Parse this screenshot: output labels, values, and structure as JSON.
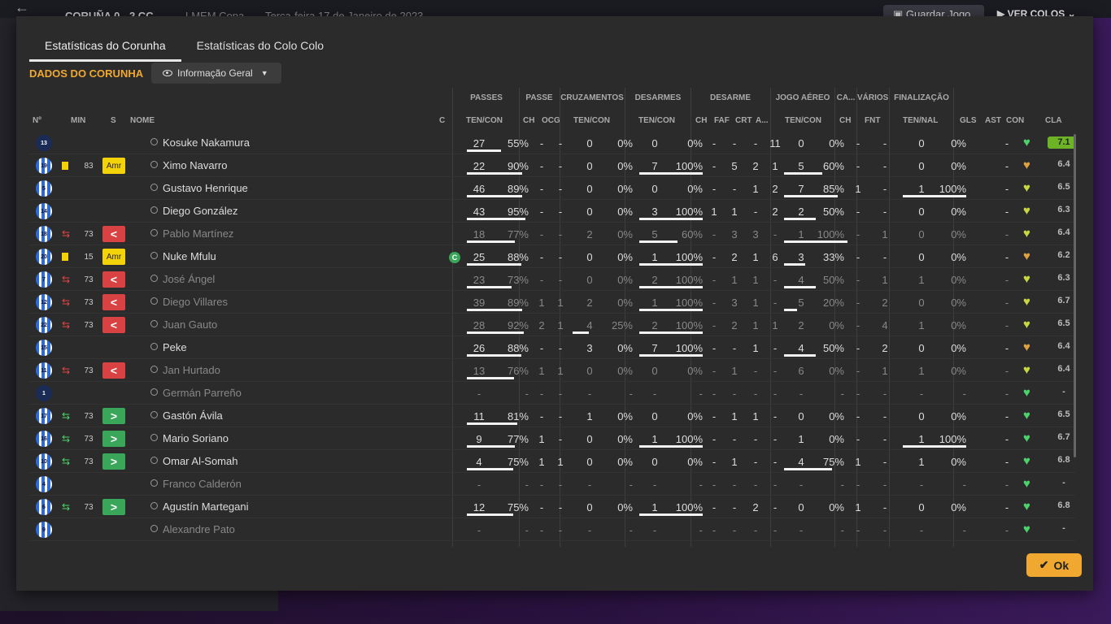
{
  "topbar": {
    "score": "CORUÑA  0 - 2  CC",
    "competition": "LMEM Copa",
    "date": "Terça-feira 17 de Janeiro de 2023",
    "save_label": "Guardar Jogo",
    "view_label": "VER COLOS"
  },
  "tabs": [
    {
      "label": "Estatísticas do Corunha",
      "active": true
    },
    {
      "label": "Estatísticas do Colo Colo",
      "active": false
    }
  ],
  "section_title": "DADOS DO CORUNHA",
  "dropdown_label": "Informação Geral",
  "group_headers": {
    "passes": "PASSES",
    "passe": "PASSE",
    "cruzamentos": "CRUZAMENTOS",
    "desarmes": "DESARMES",
    "desarme": "DESARME",
    "jogo_aereo": "JOGO AÉREO",
    "ca": "CA...",
    "varios": "VÁRIOS",
    "finalizacao": "FINALIZAÇÃO"
  },
  "columns": {
    "no": "Nº",
    "min": "MIN",
    "s": "S",
    "nome": "NOME",
    "c": "C",
    "pass_tc": "TEN/CON",
    "passe_ch": "CH",
    "passe_ocg": "OCG",
    "cruz_tc": "TEN/CON",
    "des_tc": "TEN/CON",
    "d_ch": "CH",
    "d_faf": "FAF",
    "d_crt": "CRT",
    "d_a": "A...",
    "aer_tc": "TEN/CON",
    "ca_ch": "CH",
    "fnt": "FNT",
    "fin_tn": "TEN/NAL",
    "gls": "GLS",
    "ast": "AST",
    "con": "CON",
    "cla": "CLA"
  },
  "players": [
    {
      "num": "13",
      "gk": true,
      "card": "",
      "min": "",
      "s": "",
      "name": "Kosuke Nakamura",
      "dim": false,
      "captain": false,
      "pass": [
        "27",
        "55%"
      ],
      "pch": "-",
      "pocg": "-",
      "cruz": [
        "0",
        "0%"
      ],
      "des": [
        "0",
        "0%"
      ],
      "dch": "-",
      "faf": "-",
      "crt": "-",
      "da": "11",
      "aer": [
        "0",
        "0%"
      ],
      "cach": "-",
      "fnt": "-",
      "fin": [
        "0",
        "0%"
      ],
      "gls": "",
      "ast": "-",
      "con": "green",
      "cla": "7.1",
      "best": true,
      "bars": {
        "pass": 0.55,
        "cruz": 0,
        "des": 0,
        "aer": 0,
        "fin": 0
      }
    },
    {
      "num": "19",
      "gk": false,
      "card": "yellow",
      "min": "83",
      "s": "amr",
      "name": "Ximo Navarro",
      "dim": false,
      "captain": false,
      "pass": [
        "22",
        "90%"
      ],
      "pch": "-",
      "pocg": "-",
      "cruz": [
        "0",
        "0%"
      ],
      "des": [
        "7",
        "100%"
      ],
      "dch": "-",
      "faf": "5",
      "crt": "2",
      "da": "1",
      "aer": [
        "5",
        "60%"
      ],
      "cach": "-",
      "fnt": "-",
      "fin": [
        "0",
        "0%"
      ],
      "gls": "",
      "ast": "-",
      "con": "orange",
      "cla": "6.4",
      "best": false,
      "bars": {
        "pass": 0.9,
        "cruz": 0,
        "des": 1,
        "aer": 0.6,
        "fin": 0
      }
    },
    {
      "num": "5",
      "gk": false,
      "card": "",
      "min": "",
      "s": "",
      "name": "Gustavo Henrique",
      "dim": false,
      "captain": false,
      "pass": [
        "46",
        "89%"
      ],
      "pch": "-",
      "pocg": "-",
      "cruz": [
        "0",
        "0%"
      ],
      "des": [
        "0",
        "0%"
      ],
      "dch": "-",
      "faf": "-",
      "crt": "1",
      "da": "2",
      "aer": [
        "7",
        "85%"
      ],
      "cach": "1",
      "fnt": "-",
      "fin": [
        "1",
        "100%"
      ],
      "gls": "",
      "ast": "-",
      "con": "yellow",
      "cla": "6.5",
      "best": false,
      "bars": {
        "pass": 0.89,
        "cruz": 0,
        "des": 0,
        "aer": 0.85,
        "fin": 1
      }
    },
    {
      "num": "14",
      "gk": false,
      "card": "",
      "min": "",
      "s": "",
      "name": "Diego González",
      "dim": false,
      "captain": false,
      "pass": [
        "43",
        "95%"
      ],
      "pch": "-",
      "pocg": "-",
      "cruz": [
        "0",
        "0%"
      ],
      "des": [
        "3",
        "100%"
      ],
      "dch": "1",
      "faf": "1",
      "crt": "-",
      "da": "2",
      "aer": [
        "2",
        "50%"
      ],
      "cach": "-",
      "fnt": "-",
      "fin": [
        "0",
        "0%"
      ],
      "gls": "",
      "ast": "-",
      "con": "yellow",
      "cla": "6.3",
      "best": false,
      "bars": {
        "pass": 0.95,
        "cruz": 0,
        "des": 1,
        "aer": 0.5,
        "fin": 0
      }
    },
    {
      "num": "18",
      "gk": false,
      "card": "subout",
      "min": "73",
      "s": "out",
      "name": "Pablo Martínez",
      "dim": true,
      "captain": false,
      "pass": [
        "18",
        "77%"
      ],
      "pch": "-",
      "pocg": "-",
      "cruz": [
        "2",
        "0%"
      ],
      "des": [
        "5",
        "60%"
      ],
      "dch": "-",
      "faf": "3",
      "crt": "3",
      "da": "-",
      "aer": [
        "1",
        "100%"
      ],
      "cach": "-",
      "fnt": "1",
      "fin": [
        "0",
        "0%"
      ],
      "gls": "",
      "ast": "-",
      "con": "yellow",
      "cla": "6.4",
      "best": false,
      "bars": {
        "pass": 0.77,
        "cruz": 0,
        "des": 0.6,
        "aer": 1,
        "fin": 0
      }
    },
    {
      "num": "20",
      "gk": false,
      "card": "yellow",
      "min": "15",
      "s": "amr",
      "name": "Nuke Mfulu",
      "dim": false,
      "captain": true,
      "pass": [
        "25",
        "88%"
      ],
      "pch": "-",
      "pocg": "-",
      "cruz": [
        "0",
        "0%"
      ],
      "des": [
        "1",
        "100%"
      ],
      "dch": "-",
      "faf": "2",
      "crt": "1",
      "da": "6",
      "aer": [
        "3",
        "33%"
      ],
      "cach": "-",
      "fnt": "-",
      "fin": [
        "0",
        "0%"
      ],
      "gls": "",
      "ast": "-",
      "con": "orange",
      "cla": "6.2",
      "best": false,
      "bars": {
        "pass": 0.88,
        "cruz": 0,
        "des": 1,
        "aer": 0.33,
        "fin": 0
      }
    },
    {
      "num": "7",
      "gk": false,
      "card": "subout",
      "min": "73",
      "s": "out",
      "name": "José Ángel",
      "dim": true,
      "captain": false,
      "pass": [
        "23",
        "73%"
      ],
      "pch": "-",
      "pocg": "-",
      "cruz": [
        "0",
        "0%"
      ],
      "des": [
        "2",
        "100%"
      ],
      "dch": "-",
      "faf": "1",
      "crt": "1",
      "da": "-",
      "aer": [
        "4",
        "50%"
      ],
      "cach": "-",
      "fnt": "1",
      "fin": [
        "1",
        "0%"
      ],
      "gls": "",
      "ast": "-",
      "con": "yellow",
      "cla": "6.3",
      "best": false,
      "bars": {
        "pass": 0.73,
        "cruz": 0,
        "des": 1,
        "aer": 0.5,
        "fin": 0
      }
    },
    {
      "num": "12",
      "gk": false,
      "card": "subout",
      "min": "73",
      "s": "out",
      "name": "Diego Villares",
      "dim": true,
      "captain": false,
      "pass": [
        "39",
        "89%"
      ],
      "pch": "1",
      "pocg": "1",
      "cruz": [
        "2",
        "0%"
      ],
      "des": [
        "1",
        "100%"
      ],
      "dch": "-",
      "faf": "3",
      "crt": "1",
      "da": "-",
      "aer": [
        "5",
        "20%"
      ],
      "cach": "-",
      "fnt": "2",
      "fin": [
        "0",
        "0%"
      ],
      "gls": "",
      "ast": "-",
      "con": "yellow",
      "cla": "6.7",
      "best": false,
      "bars": {
        "pass": 0.89,
        "cruz": 0,
        "des": 1,
        "aer": 0.2,
        "fin": 0
      }
    },
    {
      "num": "22",
      "gk": false,
      "card": "subout",
      "min": "73",
      "s": "out",
      "name": "Juan Gauto",
      "dim": true,
      "captain": false,
      "pass": [
        "28",
        "92%"
      ],
      "pch": "2",
      "pocg": "1",
      "cruz": [
        "4",
        "25%"
      ],
      "des": [
        "2",
        "100%"
      ],
      "dch": "-",
      "faf": "2",
      "crt": "1",
      "da": "1",
      "aer": [
        "2",
        "0%"
      ],
      "cach": "-",
      "fnt": "4",
      "fin": [
        "1",
        "0%"
      ],
      "gls": "",
      "ast": "-",
      "con": "yellow",
      "cla": "6.5",
      "best": false,
      "bars": {
        "pass": 0.92,
        "cruz": 0.25,
        "des": 1,
        "aer": 0,
        "fin": 0
      }
    },
    {
      "num": "15",
      "gk": false,
      "card": "",
      "min": "",
      "s": "",
      "name": "Peke",
      "dim": false,
      "captain": false,
      "pass": [
        "26",
        "88%"
      ],
      "pch": "-",
      "pocg": "-",
      "cruz": [
        "3",
        "0%"
      ],
      "des": [
        "7",
        "100%"
      ],
      "dch": "-",
      "faf": "-",
      "crt": "1",
      "da": "-",
      "aer": [
        "4",
        "50%"
      ],
      "cach": "-",
      "fnt": "2",
      "fin": [
        "0",
        "0%"
      ],
      "gls": "",
      "ast": "-",
      "con": "orange",
      "cla": "6.4",
      "best": false,
      "bars": {
        "pass": 0.88,
        "cruz": 0,
        "des": 1,
        "aer": 0.5,
        "fin": 0
      }
    },
    {
      "num": "11",
      "gk": false,
      "card": "subout",
      "min": "73",
      "s": "out",
      "name": "Jan Hurtado",
      "dim": true,
      "captain": false,
      "pass": [
        "13",
        "76%"
      ],
      "pch": "1",
      "pocg": "1",
      "cruz": [
        "0",
        "0%"
      ],
      "des": [
        "0",
        "0%"
      ],
      "dch": "-",
      "faf": "1",
      "crt": "-",
      "da": "-",
      "aer": [
        "6",
        "0%"
      ],
      "cach": "-",
      "fnt": "1",
      "fin": [
        "1",
        "0%"
      ],
      "gls": "",
      "ast": "-",
      "con": "yellow",
      "cla": "6.4",
      "best": false,
      "bars": {
        "pass": 0.76,
        "cruz": 0,
        "des": 0,
        "aer": 0,
        "fin": 0
      }
    },
    {
      "num": "1",
      "gk": true,
      "card": "",
      "min": "",
      "s": "",
      "name": "Germán Parreño",
      "dim": true,
      "captain": false,
      "pass": [
        "-",
        "-"
      ],
      "pch": "-",
      "pocg": "-",
      "cruz": [
        "-",
        "-"
      ],
      "des": [
        "-",
        "-"
      ],
      "dch": "-",
      "faf": "-",
      "crt": "-",
      "da": "-",
      "aer": [
        "-",
        "-"
      ],
      "cach": "-",
      "fnt": "-",
      "fin": [
        "-",
        "-"
      ],
      "gls": "",
      "ast": "-",
      "con": "green",
      "cla": "-",
      "best": false,
      "bars": {
        "pass": 0,
        "cruz": 0,
        "des": 0,
        "aer": 0,
        "fin": 0
      }
    },
    {
      "num": "17",
      "gk": false,
      "card": "subin",
      "min": "73",
      "s": "in",
      "name": "Gastón Ávila",
      "dim": false,
      "captain": false,
      "pass": [
        "11",
        "81%"
      ],
      "pch": "-",
      "pocg": "-",
      "cruz": [
        "1",
        "0%"
      ],
      "des": [
        "0",
        "0%"
      ],
      "dch": "-",
      "faf": "1",
      "crt": "1",
      "da": "-",
      "aer": [
        "0",
        "0%"
      ],
      "cach": "-",
      "fnt": "-",
      "fin": [
        "0",
        "0%"
      ],
      "gls": "",
      "ast": "-",
      "con": "green",
      "cla": "6.5",
      "best": false,
      "bars": {
        "pass": 0.81,
        "cruz": 0,
        "des": 0,
        "aer": 0,
        "fin": 0
      }
    },
    {
      "num": "16",
      "gk": false,
      "card": "subin",
      "min": "73",
      "s": "in",
      "name": "Mario Soriano",
      "dim": false,
      "captain": false,
      "pass": [
        "9",
        "77%"
      ],
      "pch": "1",
      "pocg": "-",
      "cruz": [
        "0",
        "0%"
      ],
      "des": [
        "1",
        "100%"
      ],
      "dch": "-",
      "faf": "-",
      "crt": "-",
      "da": "-",
      "aer": [
        "1",
        "0%"
      ],
      "cach": "-",
      "fnt": "-",
      "fin": [
        "1",
        "100%"
      ],
      "gls": "",
      "ast": "-",
      "con": "green",
      "cla": "6.7",
      "best": false,
      "bars": {
        "pass": 0.77,
        "cruz": 0,
        "des": 1,
        "aer": 0,
        "fin": 1
      }
    },
    {
      "num": "10",
      "gk": false,
      "card": "subin",
      "min": "73",
      "s": "in",
      "name": "Omar Al-Somah",
      "dim": false,
      "captain": false,
      "pass": [
        "4",
        "75%"
      ],
      "pch": "1",
      "pocg": "1",
      "cruz": [
        "0",
        "0%"
      ],
      "des": [
        "0",
        "0%"
      ],
      "dch": "-",
      "faf": "1",
      "crt": "-",
      "da": "-",
      "aer": [
        "4",
        "75%"
      ],
      "cach": "1",
      "fnt": "-",
      "fin": [
        "1",
        "0%"
      ],
      "gls": "",
      "ast": "-",
      "con": "green",
      "cla": "6.8",
      "best": false,
      "bars": {
        "pass": 0.75,
        "cruz": 0,
        "des": 0,
        "aer": 0.75,
        "fin": 0
      }
    },
    {
      "num": "4",
      "gk": false,
      "card": "",
      "min": "",
      "s": "",
      "name": "Franco Calderón",
      "dim": true,
      "captain": false,
      "pass": [
        "-",
        "-"
      ],
      "pch": "-",
      "pocg": "-",
      "cruz": [
        "-",
        "-"
      ],
      "des": [
        "-",
        "-"
      ],
      "dch": "-",
      "faf": "-",
      "crt": "-",
      "da": "-",
      "aer": [
        "-",
        "-"
      ],
      "cach": "-",
      "fnt": "-",
      "fin": [
        "-",
        "-"
      ],
      "gls": "",
      "ast": "-",
      "con": "green",
      "cla": "-",
      "best": false,
      "bars": {
        "pass": 0,
        "cruz": 0,
        "des": 0,
        "aer": 0,
        "fin": 0
      }
    },
    {
      "num": "6",
      "gk": false,
      "card": "subin",
      "min": "73",
      "s": "in",
      "name": "Agustín Martegani",
      "dim": false,
      "captain": false,
      "pass": [
        "12",
        "75%"
      ],
      "pch": "-",
      "pocg": "-",
      "cruz": [
        "0",
        "0%"
      ],
      "des": [
        "1",
        "100%"
      ],
      "dch": "-",
      "faf": "-",
      "crt": "2",
      "da": "-",
      "aer": [
        "0",
        "0%"
      ],
      "cach": "1",
      "fnt": "-",
      "fin": [
        "0",
        "0%"
      ],
      "gls": "",
      "ast": "-",
      "con": "green",
      "cla": "6.8",
      "best": false,
      "bars": {
        "pass": 0.75,
        "cruz": 0,
        "des": 1,
        "aer": 0,
        "fin": 0
      }
    },
    {
      "num": "9",
      "gk": false,
      "card": "",
      "min": "",
      "s": "",
      "name": "Alexandre Pato",
      "dim": true,
      "captain": false,
      "pass": [
        "-",
        "-"
      ],
      "pch": "-",
      "pocg": "-",
      "cruz": [
        "-",
        "-"
      ],
      "des": [
        "-",
        "-"
      ],
      "dch": "-",
      "faf": "-",
      "crt": "-",
      "da": "-",
      "aer": [
        "-",
        "-"
      ],
      "cach": "-",
      "fnt": "-",
      "fin": [
        "-",
        "-"
      ],
      "gls": "",
      "ast": "-",
      "con": "green",
      "cla": "-",
      "best": false,
      "bars": {
        "pass": 0,
        "cruz": 0,
        "des": 0,
        "aer": 0,
        "fin": 0
      }
    }
  ],
  "status_labels": {
    "amr": "Amr",
    "out": "<",
    "in": ">",
    "captain": "C"
  },
  "ok_label": "Ok",
  "colors": {
    "accent": "#f0a830",
    "green": "#4bd36a",
    "yellow_heart": "#c8d640",
    "orange_heart": "#e0a040",
    "best_rating": "#6cb426"
  }
}
